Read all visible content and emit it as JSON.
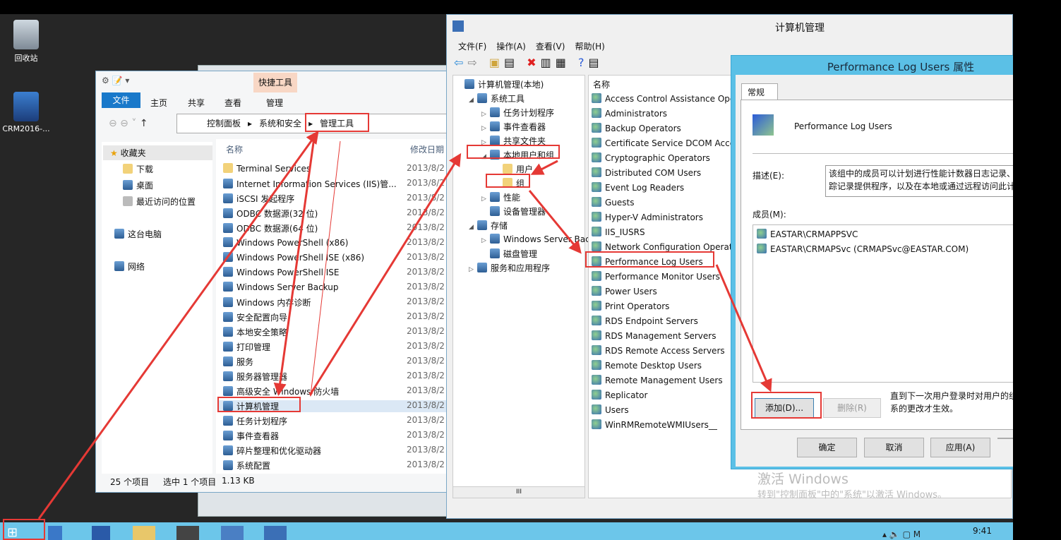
{
  "desktop": {
    "icons": [
      {
        "label": "回收站",
        "icon": "recycle-bin-icon"
      },
      {
        "label": "CRM2016-...",
        "icon": "computer-icon"
      }
    ]
  },
  "explorer": {
    "context_tab": "快捷工具",
    "tabs": [
      "文件",
      "主页",
      "共享",
      "查看",
      "管理"
    ],
    "breadcrumb": [
      "控制面板",
      "系统和安全",
      "管理工具"
    ],
    "nav": {
      "favorites": "收藏夹",
      "items": [
        "下载",
        "桌面",
        "最近访问的位置"
      ],
      "pc": "这台电脑",
      "network": "网络"
    },
    "columns": [
      "名称",
      "修改日期"
    ],
    "files": [
      {
        "name": "Terminal Services",
        "date": "2013/8/2",
        "type": "folder"
      },
      {
        "name": "Internet Information Services (IIS)管...",
        "date": "2013/8/2"
      },
      {
        "name": "iSCSI 发起程序",
        "date": "2013/8/2"
      },
      {
        "name": "ODBC 数据源(32 位)",
        "date": "2013/8/2"
      },
      {
        "name": "ODBC 数据源(64 位)",
        "date": "2013/8/2"
      },
      {
        "name": "Windows PowerShell (x86)",
        "date": "2013/8/2"
      },
      {
        "name": "Windows PowerShell ISE (x86)",
        "date": "2013/8/2"
      },
      {
        "name": "Windows PowerShell ISE",
        "date": "2013/8/2"
      },
      {
        "name": "Windows Server Backup",
        "date": "2013/8/2"
      },
      {
        "name": "Windows 内存诊断",
        "date": "2013/8/2"
      },
      {
        "name": "安全配置向导",
        "date": "2013/8/2"
      },
      {
        "name": "本地安全策略",
        "date": "2013/8/2"
      },
      {
        "name": "打印管理",
        "date": "2013/8/2"
      },
      {
        "name": "服务",
        "date": "2013/8/2"
      },
      {
        "name": "服务器管理器",
        "date": "2013/8/2"
      },
      {
        "name": "高级安全 Windows 防火墙",
        "date": "2013/8/2"
      },
      {
        "name": "计算机管理",
        "date": "2013/8/2",
        "selected": true
      },
      {
        "name": "任务计划程序",
        "date": "2013/8/2"
      },
      {
        "name": "事件查看器",
        "date": "2013/8/2"
      },
      {
        "name": "碎片整理和优化驱动器",
        "date": "2013/8/2"
      },
      {
        "name": "系统配置",
        "date": "2013/8/2"
      }
    ],
    "status": {
      "count": "25 个项目",
      "selected": "选中 1 个项目",
      "size": "1.13 KB"
    }
  },
  "compmgmt": {
    "title": "计算机管理",
    "menu": [
      "文件(F)",
      "操作(A)",
      "查看(V)",
      "帮助(H)"
    ],
    "tree": [
      {
        "label": "计算机管理(本地)",
        "level": 0
      },
      {
        "label": "系统工具",
        "level": 1,
        "exp": "◢"
      },
      {
        "label": "任务计划程序",
        "level": 2,
        "exp": "▷"
      },
      {
        "label": "事件查看器",
        "level": 2,
        "exp": "▷"
      },
      {
        "label": "共享文件夹",
        "level": 2,
        "exp": "▷"
      },
      {
        "label": "本地用户和组",
        "level": 2,
        "exp": "◢"
      },
      {
        "label": "用户",
        "level": 3
      },
      {
        "label": "组",
        "level": 3,
        "selected": true
      },
      {
        "label": "性能",
        "level": 2,
        "exp": "▷"
      },
      {
        "label": "设备管理器",
        "level": 2
      },
      {
        "label": "存储",
        "level": 1,
        "exp": "◢"
      },
      {
        "label": "Windows Server Back",
        "level": 2,
        "exp": "▷"
      },
      {
        "label": "磁盘管理",
        "level": 2
      },
      {
        "label": "服务和应用程序",
        "level": 1,
        "exp": "▷"
      }
    ],
    "column": "名称",
    "groups": [
      "Access Control Assistance Ope",
      "Administrators",
      "Backup Operators",
      "Certificate Service DCOM Acce",
      "Cryptographic Operators",
      "Distributed COM Users",
      "Event Log Readers",
      "Guests",
      "Hyper-V Administrators",
      "IIS_IUSRS",
      "Network Configuration Operat",
      "Performance Log Users",
      "Performance Monitor Users",
      "Power Users",
      "Print Operators",
      "RDS Endpoint Servers",
      "RDS Management Servers",
      "RDS Remote Access Servers",
      "Remote Desktop Users",
      "Remote Management Users",
      "Replicator",
      "Users",
      "WinRMRemoteWMIUsers__"
    ],
    "scroll_label": "III"
  },
  "dialog": {
    "title": "Performance Log Users 属性",
    "tab": "常规",
    "group_name": "Performance Log Users",
    "desc_label": "描述(E):",
    "desc_lines": [
      "该组中的成员可以计划进行性能计数器日志记录、",
      "踪记录提供程序，以及在本地或通过远程访问此计"
    ],
    "members_label": "成员(M):",
    "members": [
      "EASTAR\\CRMAPPSVC",
      "EASTAR\\CRMAPSvc (CRMAPSvc@EASTAR.COM)"
    ],
    "add": "添加(D)...",
    "remove": "删除(R)",
    "note": [
      "直到下一次用户登录时对用户的组",
      "系的更改才生效。"
    ],
    "ok": "确定",
    "cancel": "取消",
    "apply": "应用(A)"
  },
  "watermark": {
    "title": "激活 Windows",
    "sub": "转到\"控制面板\"中的\"系统\"以激活 Windows。"
  },
  "taskbar": {
    "time": "9:41",
    "color": "#6cc6ea"
  },
  "accent": "#e53935"
}
